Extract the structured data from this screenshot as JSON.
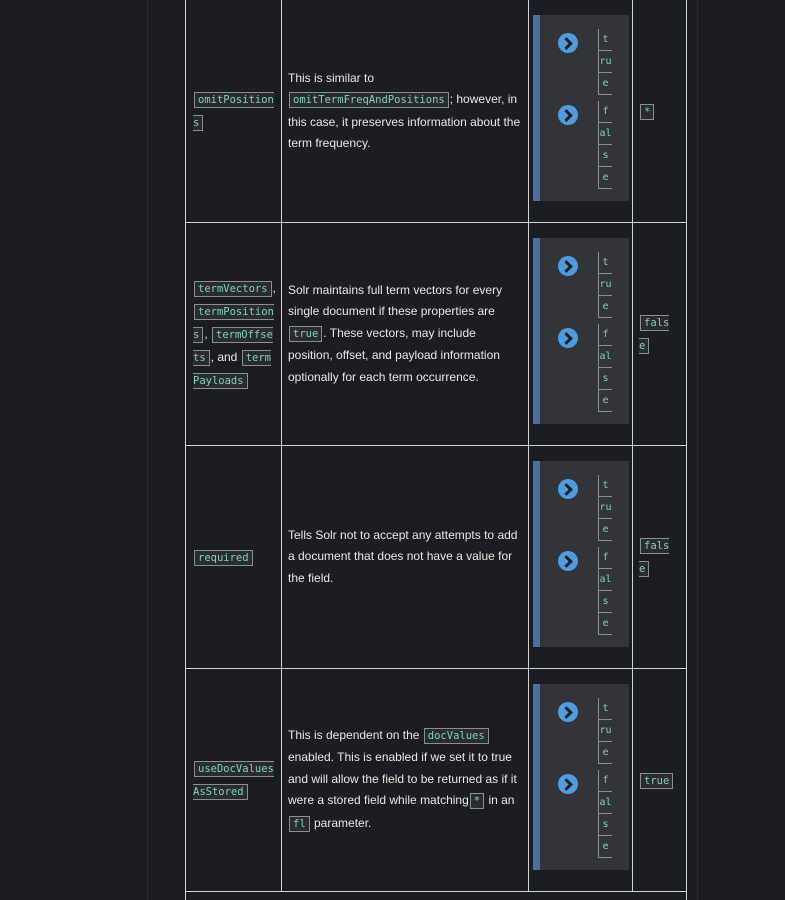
{
  "rows": [
    {
      "name": "omitPositions",
      "description": [
        "This is similar to",
        "omitTermFreqAndPositions",
        "; however, in this case, it preserves information about the term frequency."
      ],
      "options": [
        "true",
        "false"
      ],
      "default": "*"
    },
    {
      "names": [
        "termVectors",
        "termPositions",
        "termOffsets",
        "termPayloads"
      ],
      "joiner_and": "and",
      "description": [
        "Solr maintains full term vectors for every single document if these properties are",
        "true",
        ". These vectors, may include position, offset, and payload information optionally for each term occurrence."
      ],
      "options": [
        "true",
        "false"
      ],
      "default": "false"
    },
    {
      "name": "required",
      "description": [
        "Tells Solr not to accept any attempts to add a document that does not have a value for the field."
      ],
      "options": [
        "true",
        "false"
      ],
      "default": "false"
    },
    {
      "name": "useDocValuesAsStored",
      "description": [
        "This is dependent on the",
        "docValues",
        "enabled. This is enabled if we set it to true and will allow the field to be returned as if it were a stored field while matching",
        "*",
        "in an",
        "fl",
        "parameter."
      ],
      "options": [
        "true",
        "false"
      ],
      "default": "true"
    }
  ]
}
